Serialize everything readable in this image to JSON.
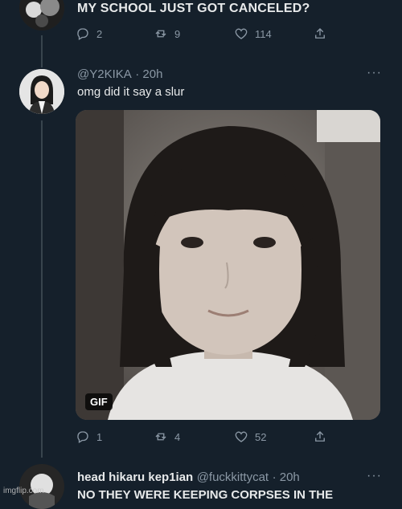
{
  "top_tweet": {
    "text": "MY SCHOOL JUST GOT CANCELED?",
    "actions": {
      "replies": "2",
      "retweets": "9",
      "likes": "114"
    }
  },
  "reply_tweet": {
    "handle": "@Y2KIKA",
    "time": "· 20h",
    "text": "omg did it say a slur",
    "media": {
      "badge": "GIF"
    },
    "actions": {
      "replies": "1",
      "retweets": "4",
      "likes": "52"
    }
  },
  "next_tweet": {
    "name": "head hikaru kep1ian",
    "handle": "@fuckkittycat",
    "time": "· 20h",
    "text": "NO THEY WERE KEEPING CORPSES IN THE"
  },
  "icons": {
    "reply": "reply-icon",
    "retweet": "retweet-icon",
    "like": "heart-icon",
    "share": "share-icon",
    "more": "more-icon"
  },
  "watermark": "imgflip.com",
  "colors": {
    "background": "#15202b",
    "muted": "#8b98a5",
    "line": "#38444d"
  }
}
